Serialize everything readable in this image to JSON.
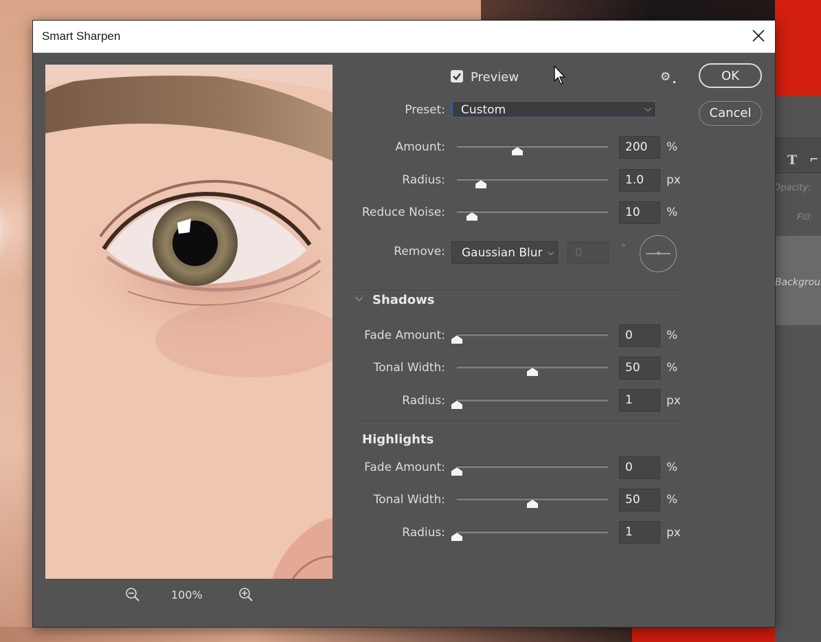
{
  "background_app": {
    "panel_labels": [
      "Opacity:",
      "Fill:"
    ],
    "layer_name": "Background"
  },
  "dialog": {
    "title": "Smart Sharpen",
    "preview_checkbox": {
      "label": "Preview",
      "checked": true
    },
    "zoom": {
      "level": "100%"
    },
    "preset": {
      "label": "Preset:",
      "value": "Custom"
    },
    "buttons": {
      "ok": "OK",
      "cancel": "Cancel"
    },
    "main": {
      "amount": {
        "label": "Amount:",
        "value": "200",
        "unit": "%",
        "fraction": 0.4
      },
      "radius": {
        "label": "Radius:",
        "value": "1.0",
        "unit": "px",
        "fraction": 0.16
      },
      "reduce_noise": {
        "label": "Reduce Noise:",
        "value": "10",
        "unit": "%",
        "fraction": 0.1
      }
    },
    "remove": {
      "label": "Remove:",
      "value": "Gaussian Blur",
      "angle": "0",
      "degree_symbol": "°"
    },
    "shadows": {
      "title": "Shadows",
      "fade_amount": {
        "label": "Fade Amount:",
        "value": "0",
        "unit": "%",
        "fraction": 0.0
      },
      "tonal_width": {
        "label": "Tonal Width:",
        "value": "50",
        "unit": "%",
        "fraction": 0.5
      },
      "radius": {
        "label": "Radius:",
        "value": "1",
        "unit": "px",
        "fraction": 0.0
      }
    },
    "highlights": {
      "title": "Highlights",
      "fade_amount": {
        "label": "Fade Amount:",
        "value": "0",
        "unit": "%",
        "fraction": 0.0
      },
      "tonal_width": {
        "label": "Tonal Width:",
        "value": "50",
        "unit": "%",
        "fraction": 0.5
      },
      "radius": {
        "label": "Radius:",
        "value": "1",
        "unit": "px",
        "fraction": 0.0
      }
    }
  },
  "colors": {
    "dialog_bg": "#535353",
    "field_bg": "#454545",
    "focus_border": "#1e6fc7",
    "canvas_red": "#d21f0e"
  },
  "icons": {
    "close": "close-icon",
    "gear": "gear-icon",
    "zoom_out": "zoom-out-icon",
    "zoom_in": "zoom-in-icon",
    "chevron": "chevron-down-icon"
  }
}
